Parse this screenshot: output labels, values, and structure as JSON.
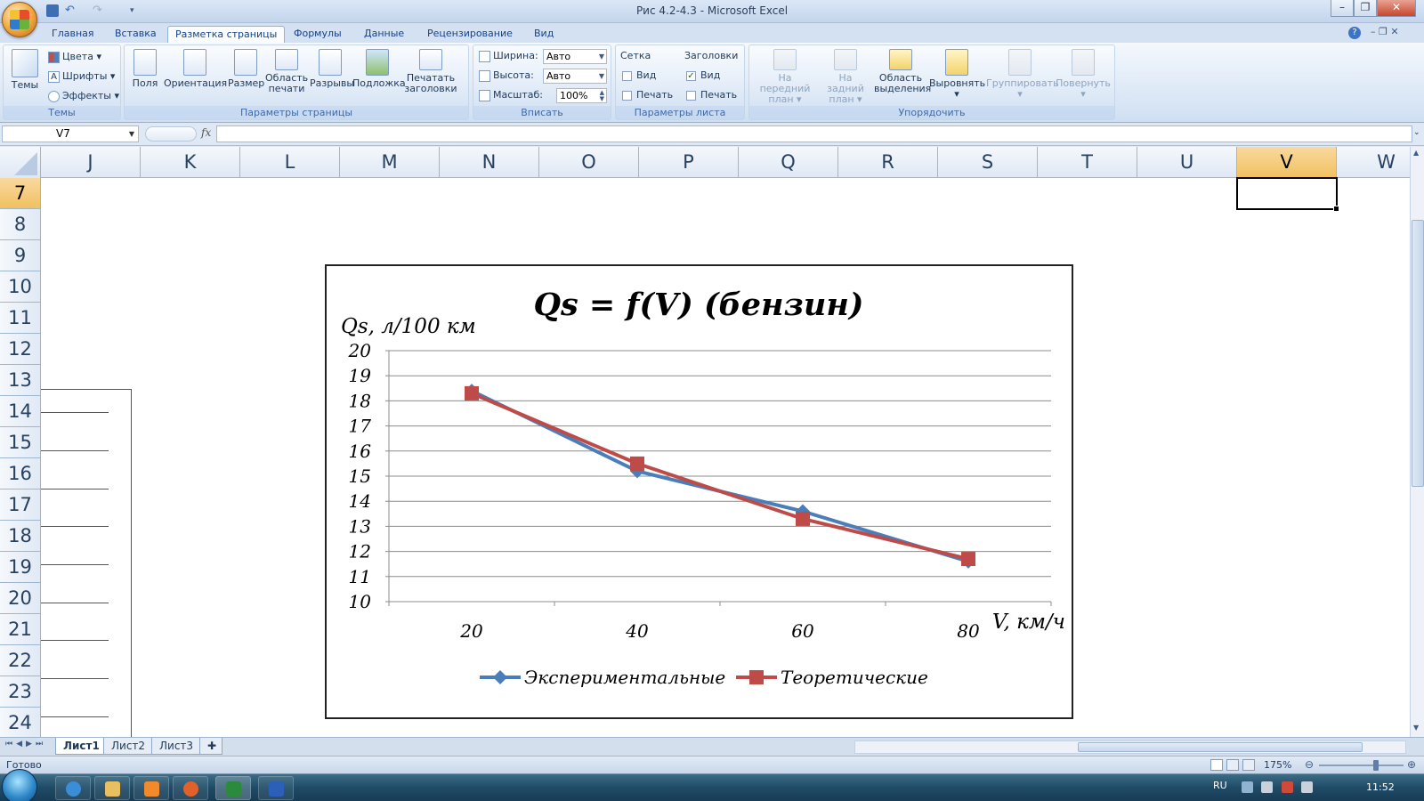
{
  "window": {
    "title": "Рис 4.2-4.3 - Microsoft Excel"
  },
  "tabs": [
    "Главная",
    "Вставка",
    "Разметка страницы",
    "Формулы",
    "Данные",
    "Рецензирование",
    "Вид"
  ],
  "active_tab": "Разметка страницы",
  "ribbon": {
    "themes": {
      "themes_btn": "Темы",
      "colors": "Цвета",
      "fonts": "Шрифты",
      "effects": "Эффекты",
      "label": "Темы"
    },
    "page_setup": {
      "margins": "Поля",
      "orientation": "Ориентация",
      "size": "Размер",
      "print_area_1": "Область",
      "print_area_2": "печати",
      "breaks": "Разрывы",
      "background": "Подложка",
      "print_titles_1": "Печатать",
      "print_titles_2": "заголовки",
      "label": "Параметры страницы"
    },
    "scale_to_fit": {
      "width_label": "Ширина:",
      "width_value": "Авто",
      "height_label": "Высота:",
      "height_value": "Авто",
      "scale_label": "Масштаб:",
      "scale_value": "100%",
      "label": "Вписать"
    },
    "sheet_options": {
      "gridlines": "Сетка",
      "headings": "Заголовки",
      "view": "Вид",
      "print": "Печать",
      "label": "Параметры листа"
    },
    "arrange": {
      "bring_front_1": "На передний",
      "bring_front_2": "план",
      "send_back_1": "На задний",
      "send_back_2": "план",
      "selection_1": "Область",
      "selection_2": "выделения",
      "align": "Выровнять",
      "group": "Группировать",
      "rotate": "Повернуть",
      "label": "Упорядочить"
    }
  },
  "formula_bar": {
    "name_box": "V7",
    "fx": "fx"
  },
  "columns": [
    "J",
    "K",
    "L",
    "M",
    "N",
    "O",
    "P",
    "Q",
    "R",
    "S",
    "T",
    "U",
    "V",
    "W"
  ],
  "selected_column": "V",
  "rows": [
    "7",
    "8",
    "9",
    "10",
    "11",
    "12",
    "13",
    "14",
    "15",
    "16",
    "17",
    "18",
    "19",
    "20",
    "21",
    "22",
    "23",
    "24"
  ],
  "selected_row": "7",
  "chart_data": {
    "type": "line",
    "title": "Qs = f(V) (бензин)",
    "ylabel": "Qs, л/100 км",
    "xlabel": "V, км/ч",
    "categories": [
      "20",
      "40",
      "60",
      "80"
    ],
    "ylim": [
      10,
      20
    ],
    "yticks": [
      "10",
      "11",
      "12",
      "13",
      "14",
      "15",
      "16",
      "17",
      "18",
      "19",
      "20"
    ],
    "grid": true,
    "legend_position": "bottom",
    "series": [
      {
        "name": "Экспериментальные",
        "values": [
          18.4,
          15.2,
          13.6,
          11.6
        ],
        "color": "#4a7ebb",
        "marker": "diamond"
      },
      {
        "name": "Теоретические",
        "values": [
          18.3,
          15.5,
          13.3,
          11.7
        ],
        "color": "#be4b48",
        "marker": "square"
      }
    ]
  },
  "sheets": [
    "Лист1",
    "Лист2",
    "Лист3"
  ],
  "active_sheet": "Лист1",
  "status": {
    "ready": "Готово",
    "zoom": "175%"
  },
  "taskbar": {
    "lang": "RU",
    "clock": "11:52"
  }
}
